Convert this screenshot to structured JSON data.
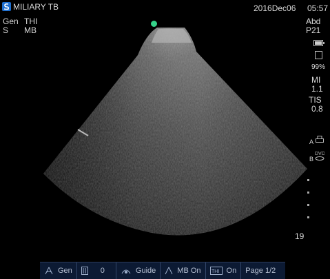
{
  "header": {
    "title": "MILIARY TB",
    "date": "2016Dec06",
    "time": "05:57"
  },
  "left_info": {
    "preset": "Gen",
    "thi": "THI",
    "s": "S",
    "mb": "MB"
  },
  "right_info": {
    "exam": "Abd",
    "probe": "P21",
    "battery_percent": "99%",
    "battery_level": 0.99,
    "mi_label": "MI",
    "mi_value": "1.1",
    "tis_label": "TIS",
    "tis_value": "0.8",
    "a_label": "A",
    "b_label": "B",
    "depth": "19"
  },
  "footer": {
    "items": [
      {
        "icon": "gain-icon",
        "label": "Gen"
      },
      {
        "icon": "depth-icon",
        "label": "0"
      },
      {
        "icon": "guide-icon",
        "label": "Guide"
      },
      {
        "icon": "mb-icon",
        "label": "MB On"
      },
      {
        "icon": "thi-icon",
        "label": "On"
      },
      {
        "icon": "page-icon",
        "label": "Page 1/2"
      }
    ]
  },
  "colors": {
    "background": "#000000",
    "text": "#d8d8d8",
    "logo": "#1e6fd0",
    "orientation_marker": "#35d38a",
    "footer_bg": "#0c1a33"
  }
}
